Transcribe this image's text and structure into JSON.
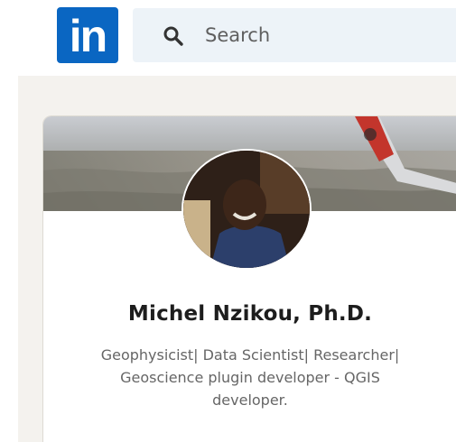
{
  "nav": {
    "logo_text": "in",
    "search_placeholder": "Search",
    "search_icon": "search-icon",
    "brand_color": "#0a66c2"
  },
  "profile": {
    "name": "Michel Nzikou, Ph.D.",
    "headline": "Geophysicist| Data Scientist| Researcher| Geoscience plugin developer - QGIS developer."
  }
}
